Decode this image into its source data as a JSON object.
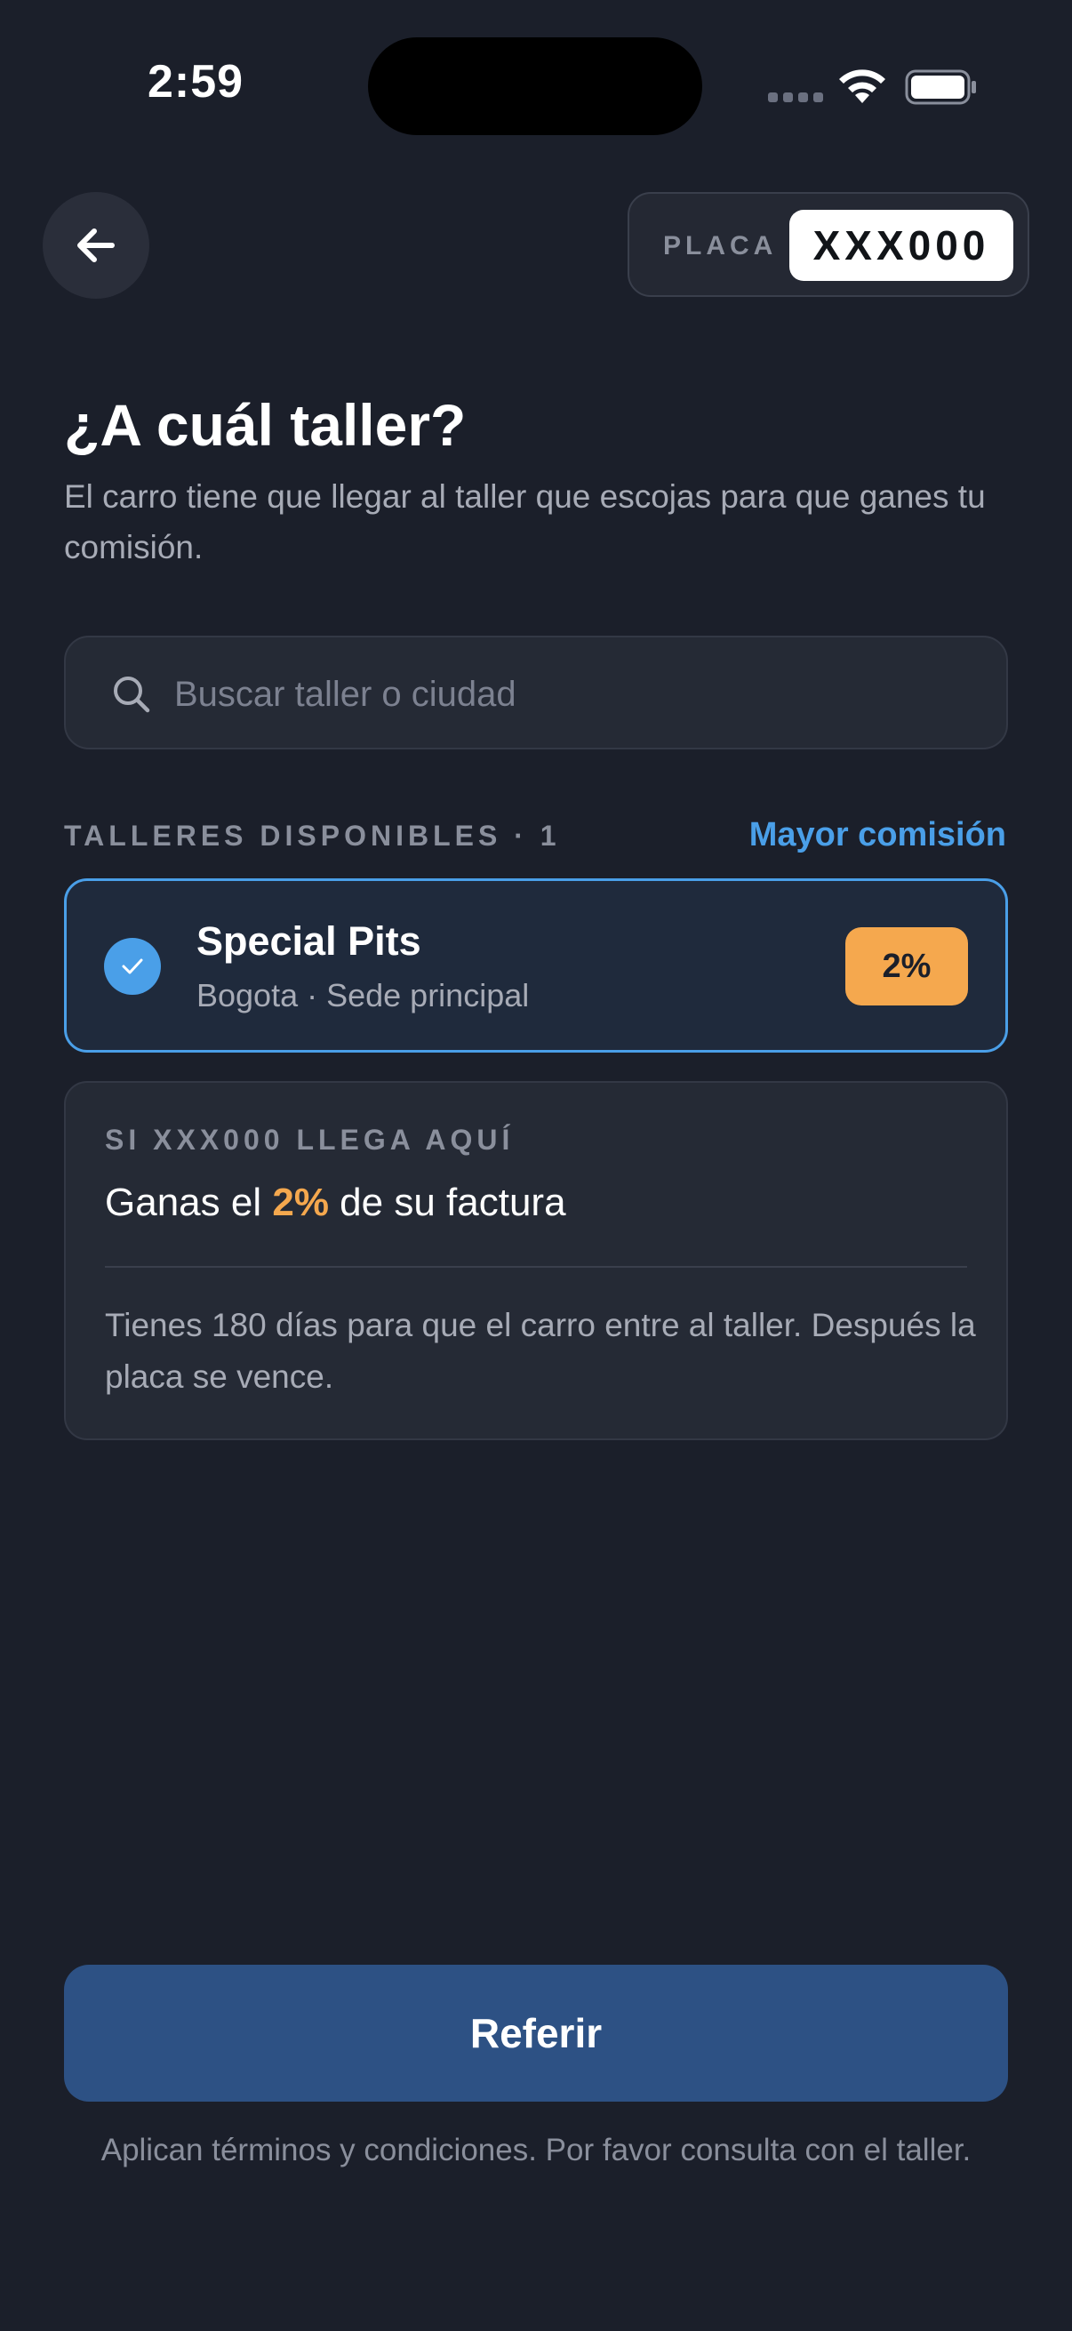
{
  "status_bar": {
    "time": "2:59",
    "wifi_icon": "wifi-icon",
    "battery_icon": "battery-icon"
  },
  "header": {
    "back_icon": "arrow-left-icon",
    "plate_label": "PLACA",
    "plate_value": "XXX000"
  },
  "title": "¿A cuál taller?",
  "subtitle": "El carro tiene que llegar al taller que escojas para que ganes tu comisión.",
  "search": {
    "placeholder": "Buscar taller o ciudad",
    "value": "",
    "icon": "search-icon"
  },
  "section": {
    "label": "TALLERES DISPONIBLES · 1",
    "sort_label": "Mayor comisión"
  },
  "shops": [
    {
      "name": "Special Pits",
      "location": "Bogota · Sede principal",
      "commission": "2%",
      "selected": true
    }
  ],
  "info": {
    "kicker": "SI XXX000 LLEGA AQUÍ",
    "earn_prefix": "Ganas el",
    "earn_pct": "2%",
    "earn_suffix": "de su factura",
    "note": "Tienes 180 días para que el carro entre al taller. Después la placa se vence."
  },
  "footer": {
    "button_label": "Referir",
    "terms": "Aplican términos y condiciones. Por favor consulta con el taller."
  },
  "colors": {
    "background": "#1b1f2a",
    "accent": "#4a9fe8",
    "commission": "#f5a84e",
    "button": "#2d5184"
  }
}
